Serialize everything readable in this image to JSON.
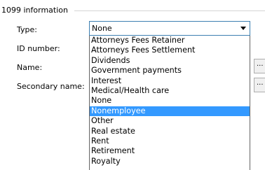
{
  "group": {
    "title": "1099 information"
  },
  "form": {
    "type_label": "Type:",
    "id_label": "ID number:",
    "name_label": "Name:",
    "secondary_label": "Secondary name:",
    "type_value": "None",
    "name_button_label": "...",
    "secondary_button_label": "..."
  },
  "dropdown": {
    "options": [
      "Attorneys Fees Retainer",
      "Attorneys Fees Settlement",
      "Dividends",
      "Government payments",
      "Interest",
      "Medical/Health care",
      "None",
      "Nonemployee",
      "Other",
      "Real estate",
      "Rent",
      "Retirement",
      "Royalty"
    ],
    "highlighted_option": "Nonemployee"
  },
  "colors": {
    "highlight": "#3399ff",
    "combo_border": "#3c7fb1",
    "list_border": "#646464"
  }
}
